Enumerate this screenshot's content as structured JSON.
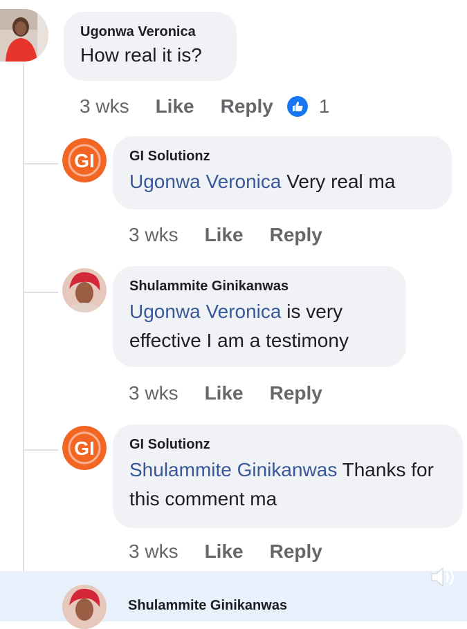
{
  "comments": [
    {
      "author": "Ugonwa Veronica",
      "mention": "",
      "text": "How real it is?",
      "time": "3 wks",
      "like_label": "Like",
      "reply_label": "Reply",
      "reaction_count": "1",
      "avatar_icon": "person-photo"
    }
  ],
  "replies": [
    {
      "author": "GI Solutionz",
      "mention": "Ugonwa Veronica",
      "text": " Very real ma",
      "time": "3 wks",
      "like_label": "Like",
      "reply_label": "Reply",
      "avatar_icon": "gi-logo"
    },
    {
      "author": "Shulammite Ginikanwas",
      "mention": "Ugonwa Veronica",
      "text": " is very effective I am a testimony",
      "time": "3 wks",
      "like_label": "Like",
      "reply_label": "Reply",
      "avatar_icon": "person-photo"
    },
    {
      "author": "GI Solutionz",
      "mention": "Shulammite Ginikanwas",
      "text": " Thanks for this comment ma",
      "time": "3 wks",
      "like_label": "Like",
      "reply_label": "Reply",
      "avatar_icon": "gi-logo"
    },
    {
      "author": "Shulammite Ginikanwas",
      "avatar_icon": "person-photo"
    }
  ],
  "colors": {
    "bubble": "#f0f2f5",
    "mention": "#385898",
    "like_reaction": "#1877f2",
    "gi_logo": "#f26522"
  }
}
